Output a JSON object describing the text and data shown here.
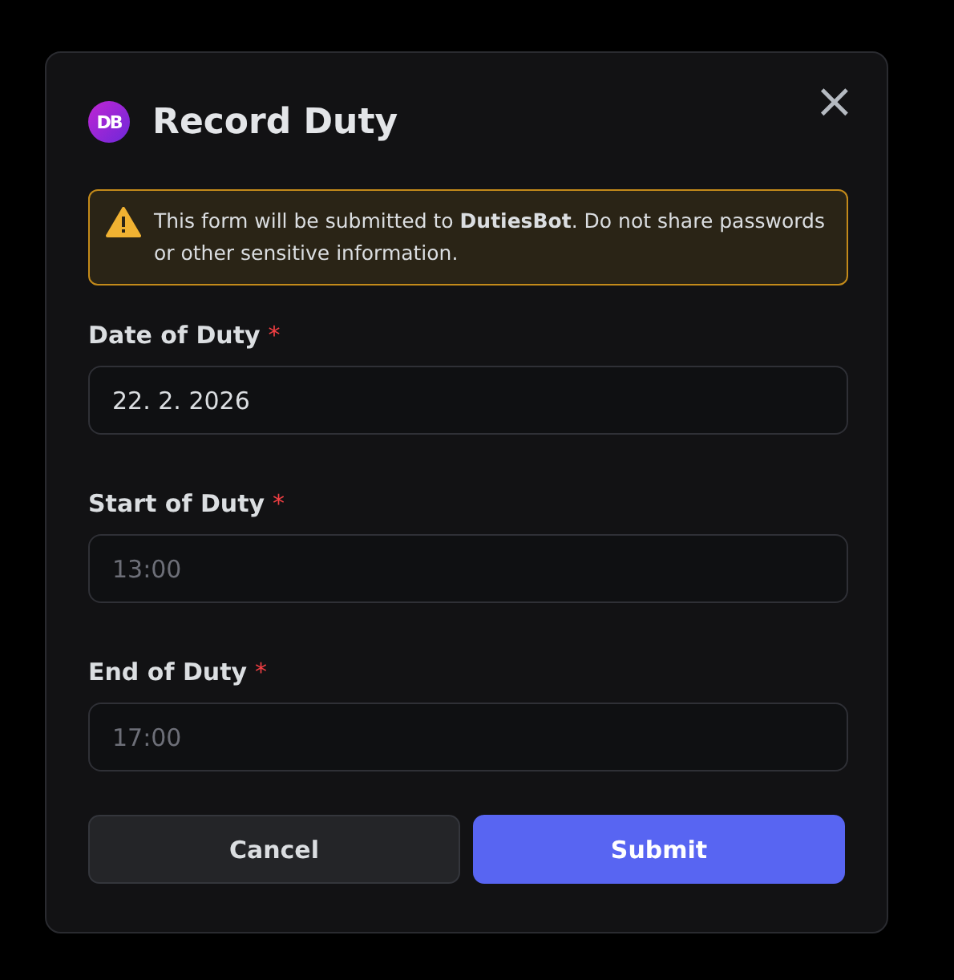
{
  "dialog": {
    "logo_text": "DB",
    "title": "Record Duty",
    "close_symbol": "×",
    "warning": "This form will be submitted to **DutiesBot**. Do not share passwords or other sensitive information.",
    "fields": [
      {
        "label": "Date of Duty",
        "required_mark": "*",
        "value": "22. 2. 2026"
      },
      {
        "label": "Start of Duty",
        "required_mark": "*",
        "placeholder": "13:00"
      },
      {
        "label": "End of Duty",
        "required_mark": "*",
        "placeholder": "17:00"
      }
    ],
    "buttons": [
      {
        "label": "Cancel",
        "kind": "secondary"
      },
      {
        "label": "Submit",
        "kind": "primary"
      }
    ]
  }
}
